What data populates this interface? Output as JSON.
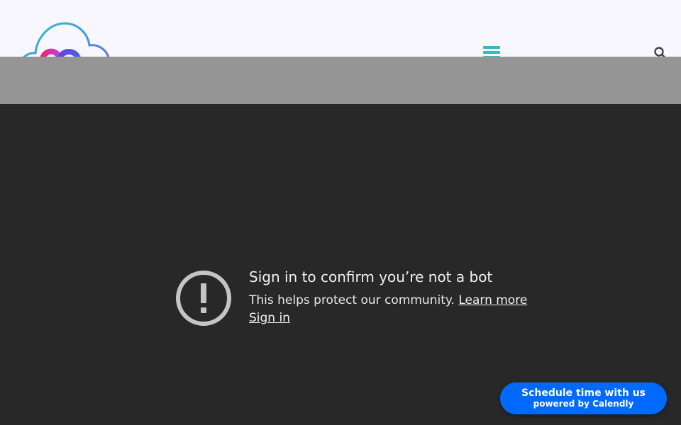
{
  "header": {
    "logo_icon": "cloud-ca-logo-icon",
    "menu_icon": "hamburger-menu-icon",
    "search_icon": "search-icon",
    "colors": {
      "header_bg": "#f8f7fd",
      "band_bg": "#959595",
      "menu_accent": "#3bb7c4"
    }
  },
  "embed": {
    "icon": "alert-circle-icon",
    "title": "Sign in to confirm you’re not a bot",
    "body": "This helps protect our community.",
    "learn_more_label": "Learn more",
    "sign_in_label": "Sign in",
    "colors": {
      "background": "#282828",
      "text": "#f1f1f1",
      "icon": "#c4c4c4"
    }
  },
  "calendly": {
    "main_label": "Schedule time with us",
    "sub_label": "powered by Calendly",
    "color": "#0069ff"
  }
}
